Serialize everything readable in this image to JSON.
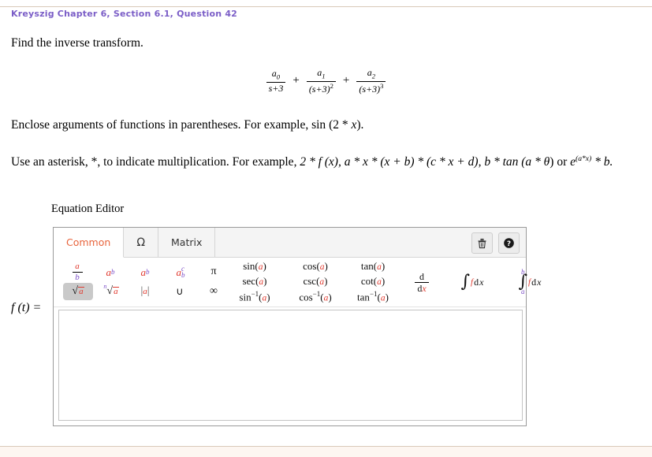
{
  "header": {
    "question_title": "Kreyszig Chapter 6, Section 6.1, Question 42"
  },
  "prompt": {
    "find_line": "Find the inverse transform.",
    "enclose_prefix": "Enclose arguments of functions in parentheses. For example, ",
    "enclose_example_fn": "sin",
    "enclose_example_arg": " (2 * ",
    "enclose_example_var": "x",
    "enclose_example_end": ").",
    "asterisk_prefix": "Use an asterisk, *, to indicate multiplication. For example, ",
    "asterisk_ex1": "2 * ",
    "asterisk_ex1_f": "f",
    "asterisk_ex1_arg": " (x)",
    "asterisk_ex2": ", a * x * (x + b) * (c * x + d)",
    "asterisk_ex3": ", b * tan (a * ",
    "asterisk_theta": "θ",
    "asterisk_ex4": ") or ",
    "asterisk_e": "e",
    "asterisk_exponent": "(a*x)",
    "asterisk_ex5": " * b."
  },
  "equation": {
    "term1": {
      "numerator": "a",
      "num_sub": "0",
      "denominator": "s+3",
      "den_sup": ""
    },
    "term2": {
      "numerator": "a",
      "num_sub": "1",
      "denominator": "(s+3)",
      "den_sup": "2"
    },
    "term3": {
      "numerator": "a",
      "num_sub": "2",
      "denominator": "(s+3)",
      "den_sup": "3"
    },
    "operator": "+"
  },
  "editor": {
    "title": "Equation Editor",
    "answer_label_f": "f",
    "answer_label_rest": " (t) =",
    "tabs": [
      {
        "label": "Common",
        "active": true
      },
      {
        "label": "Ω",
        "active": false
      },
      {
        "label": "Matrix",
        "active": false
      }
    ],
    "tools": [
      {
        "name": "delete-icon",
        "title": "Delete"
      },
      {
        "name": "help-icon",
        "title": "Help"
      }
    ],
    "palette": {
      "row1": [
        {
          "name": "fraction",
          "num": "a",
          "den": "b"
        },
        {
          "name": "superscript",
          "base": "a",
          "sup": "b"
        },
        {
          "name": "subscript",
          "base": "a",
          "sub": "b"
        },
        {
          "name": "subsuperscript",
          "base": "a",
          "sub": "b",
          "sup": "c"
        },
        {
          "name": "pi",
          "glyph": "π"
        }
      ],
      "row2": [
        {
          "name": "square-root",
          "radicand": "a",
          "highlighted": true
        },
        {
          "name": "nth-root",
          "index": "n",
          "radicand": "a"
        },
        {
          "name": "absolute-value",
          "value": "a"
        },
        {
          "name": "union",
          "glyph": "∪"
        },
        {
          "name": "infinity",
          "glyph": "∞"
        }
      ],
      "functions": [
        [
          "sin",
          "cos",
          "tan"
        ],
        [
          "sec",
          "csc",
          "cot"
        ],
        [
          "sin-inverse",
          "cos-inverse",
          "tan-inverse"
        ]
      ],
      "function_labels": [
        [
          "sin",
          "cos",
          "tan"
        ],
        [
          "sec",
          "csc",
          "cot"
        ],
        [
          "sin",
          "cos",
          "tan"
        ]
      ],
      "function_arg": "a",
      "inverse_marker": "−1",
      "calculus": [
        {
          "name": "derivative",
          "num": "d",
          "den_prefix": "d",
          "den_var": "x"
        },
        {
          "name": "indefinite-integral",
          "integrand": "f",
          "differential": "d",
          "var": "x"
        },
        {
          "name": "definite-integral",
          "lower": "a",
          "upper": "b",
          "integrand": "f",
          "differential": "d",
          "var": "x"
        }
      ]
    },
    "answer_input": {
      "value": "",
      "placeholder": ""
    }
  },
  "colors": {
    "title_purple": "#7b5ec7",
    "tab_active_orange": "#e8643c",
    "placeholder_red": "#e03a2f",
    "placeholder_purple": "#7b4ec7",
    "rule_tan": "#d9c9b8"
  }
}
